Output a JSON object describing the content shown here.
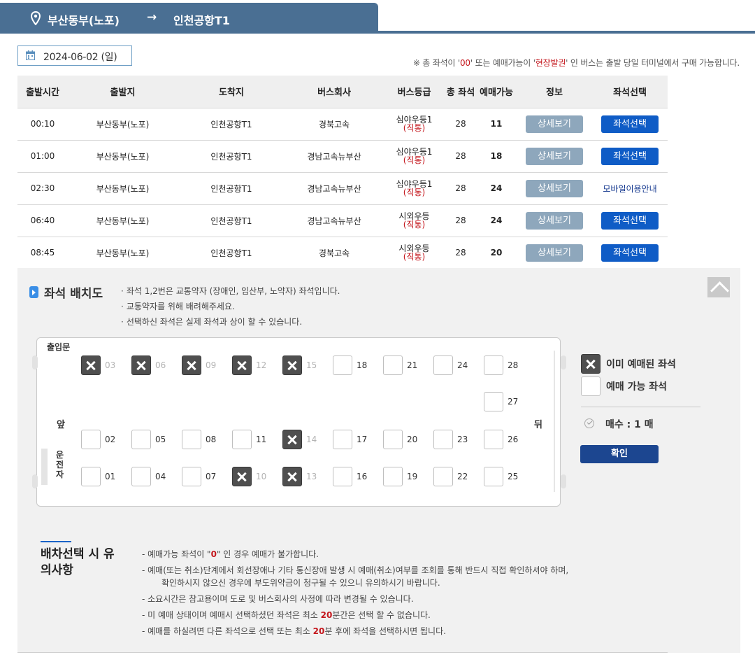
{
  "route": {
    "from": "부산동부(노포)",
    "to": "인천공항T1",
    "arrow": "→"
  },
  "date": "2024-06-02 (일)",
  "notice": {
    "pre": "※ 총 좌석이 '",
    "zero": "00",
    "mid": "' 또는 예매가능이 '",
    "onsite": "현장발권",
    "post": "' 인 버스는 출발 당일 터미널에서 구매 가능합니다."
  },
  "table": {
    "headers": [
      "출발시간",
      "출발지",
      "도착지",
      "버스회사",
      "버스등급",
      "총 좌석",
      "예매가능",
      "정보",
      "좌석선택"
    ],
    "rows": [
      {
        "time": "00:10",
        "from": "부산동부(노포)",
        "to": "인천공항T1",
        "company": "경북고속",
        "grade": "심야우등1",
        "grade_sub": "(직통)",
        "total": "28",
        "avail": "11",
        "info": "상세보기",
        "select": "좌석선택"
      },
      {
        "time": "01:00",
        "from": "부산동부(노포)",
        "to": "인천공항T1",
        "company": "경남고속뉴부산",
        "grade": "심야우등1",
        "grade_sub": "(직통)",
        "total": "28",
        "avail": "18",
        "info": "상세보기",
        "select": "좌석선택"
      },
      {
        "time": "02:30",
        "from": "부산동부(노포)",
        "to": "인천공항T1",
        "company": "경남고속뉴부산",
        "grade": "심야우등1",
        "grade_sub": "(직통)",
        "total": "28",
        "avail": "24",
        "info": "상세보기",
        "select": "모바일이용안내"
      },
      {
        "time": "06:40",
        "from": "부산동부(노포)",
        "to": "인천공항T1",
        "company": "경남고속뉴부산",
        "grade": "시외우등",
        "grade_sub": "(직통)",
        "total": "28",
        "avail": "24",
        "info": "상세보기",
        "select": "좌석선택"
      },
      {
        "time": "08:45",
        "from": "부산동부(노포)",
        "to": "인천공항T1",
        "company": "경북고속",
        "grade": "시외우등",
        "grade_sub": "(직통)",
        "total": "28",
        "avail": "20",
        "info": "상세보기",
        "select": "좌석선택"
      }
    ]
  },
  "seat_section": {
    "title": "좌석 배치도",
    "notes": [
      "좌석 1,2번은 교통약자 (장애인, 임산부, 노약자) 좌석입니다.",
      "교통약자를 위해 배려해주세요.",
      "선택하신 좌석은 실제 좌석과 상이 할 수 있습니다."
    ],
    "entrance": "출입문",
    "front": "앞",
    "back": "뒤",
    "driver": "운전자",
    "seats": [
      {
        "n": "03",
        "booked": true
      },
      {
        "n": "06",
        "booked": true
      },
      {
        "n": "09",
        "booked": true
      },
      {
        "n": "12",
        "booked": true
      },
      {
        "n": "15",
        "booked": true
      },
      {
        "n": "18",
        "booked": false
      },
      {
        "n": "21",
        "booked": false
      },
      {
        "n": "24",
        "booked": false
      },
      {
        "n": "28",
        "booked": false
      },
      {
        "n": "27",
        "booked": false
      },
      {
        "n": "02",
        "booked": false
      },
      {
        "n": "05",
        "booked": false
      },
      {
        "n": "08",
        "booked": false
      },
      {
        "n": "11",
        "booked": false
      },
      {
        "n": "14",
        "booked": true
      },
      {
        "n": "17",
        "booked": false
      },
      {
        "n": "20",
        "booked": false
      },
      {
        "n": "23",
        "booked": false
      },
      {
        "n": "26",
        "booked": false
      },
      {
        "n": "01",
        "booked": false
      },
      {
        "n": "04",
        "booked": false
      },
      {
        "n": "07",
        "booked": false
      },
      {
        "n": "10",
        "booked": true
      },
      {
        "n": "13",
        "booked": true
      },
      {
        "n": "16",
        "booked": false
      },
      {
        "n": "19",
        "booked": false
      },
      {
        "n": "22",
        "booked": false
      },
      {
        "n": "25",
        "booked": false
      }
    ],
    "legend_booked": "이미 예매된 좌석",
    "legend_available": "예매 가능 좌석",
    "count_label": "매수 : 1 매",
    "confirm": "확인"
  },
  "caution": {
    "title": "배차선택 시 유의사항",
    "items": [
      {
        "pre": "- 예매가능 좌석이 \"",
        "red": "0",
        "post": "\" 인 경우 예매가 불가합니다."
      },
      {
        "pre": "- 예매(또는 취소)단계에서 회선장애나 기타 통신장애 발생 시 예매(취소)여부를 조회를 통해 반드시 직접 확인하셔야 하며,",
        "cont": "확인하시지 않으신 경우에 부도위약금이 청구될 수 있으니 유의하시기 바랍니다."
      },
      {
        "pre": "- 소요시간은 참고용이며 도로 및 버스회사의 사정에 따라 변경될 수 있습니다."
      },
      {
        "pre": "- 미 예매 상태이며 예매시 선택하셨던 좌석은 최소 ",
        "red": "20",
        "post": "분간은 선택 할 수 없습니다."
      },
      {
        "pre": "- 예매를 하실려면 다른 좌석으로 선택 또는 최소 ",
        "red": "20",
        "post": "분 후에 좌석을 선택하시면 됩니다."
      }
    ]
  },
  "colors": {
    "header": "#4a6f93",
    "select_button": "#0f5cc6",
    "detail_button": "#8ea7bc",
    "confirm_button": "#1c4690",
    "red": "#c4161c"
  }
}
